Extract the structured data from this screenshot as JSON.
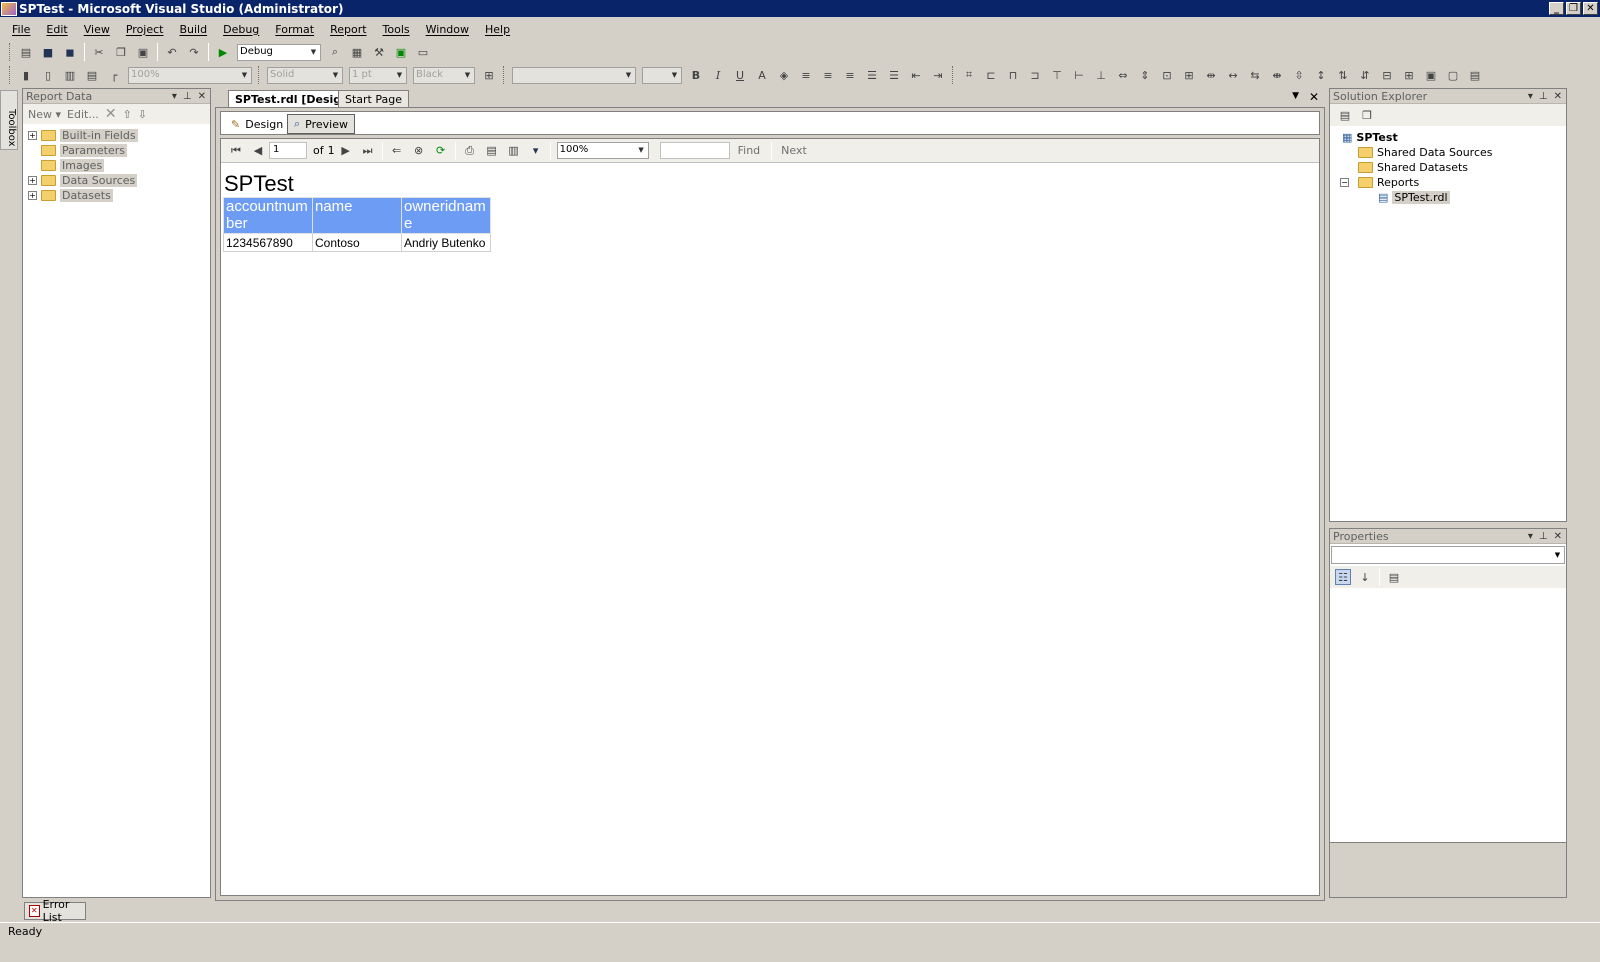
{
  "window": {
    "title": "SPTest - Microsoft Visual Studio (Administrator)"
  },
  "menu": [
    "File",
    "Edit",
    "View",
    "Project",
    "Build",
    "Debug",
    "Format",
    "Report",
    "Tools",
    "Window",
    "Help"
  ],
  "toolbar1": {
    "config": "Debug"
  },
  "toolbar2": {
    "zoom": "100%",
    "border_style": "Solid",
    "border_width": "1 pt",
    "border_color": "Black"
  },
  "toolbox": {
    "label": "Toolbox"
  },
  "report_data": {
    "title": "Report Data",
    "new_label": "New ▾",
    "edit_label": "Edit...",
    "items": [
      {
        "label": "Built-in Fields",
        "expandable": true
      },
      {
        "label": "Parameters",
        "expandable": false
      },
      {
        "label": "Images",
        "expandable": false
      },
      {
        "label": "Data Sources",
        "expandable": true
      },
      {
        "label": "Datasets",
        "expandable": true
      }
    ]
  },
  "doc_tabs": {
    "active": "SPTest.rdl [Design]",
    "other": "Start Page"
  },
  "view_tabs": {
    "design": "Design",
    "preview": "Preview"
  },
  "preview_toolbar": {
    "page": "1",
    "of_label": "of",
    "total": "1",
    "zoom": "100%",
    "find": "Find",
    "next": "Next"
  },
  "report": {
    "title": "SPTest",
    "columns": [
      "accountnumber",
      "name",
      "owneridname"
    ],
    "rows": [
      [
        "1234567890",
        "Contoso",
        "Andriy Butenko"
      ]
    ]
  },
  "solution_explorer": {
    "title": "Solution Explorer",
    "project": "SPTest",
    "folders": [
      "Shared Data Sources",
      "Shared Datasets",
      "Reports"
    ],
    "report_file": "SPTest.rdl"
  },
  "properties": {
    "title": "Properties"
  },
  "bottom": {
    "error_list": "Error List",
    "status": "Ready"
  },
  "colors": {
    "title_bar": "#0a246a",
    "report_header": "#6d9cf5"
  }
}
